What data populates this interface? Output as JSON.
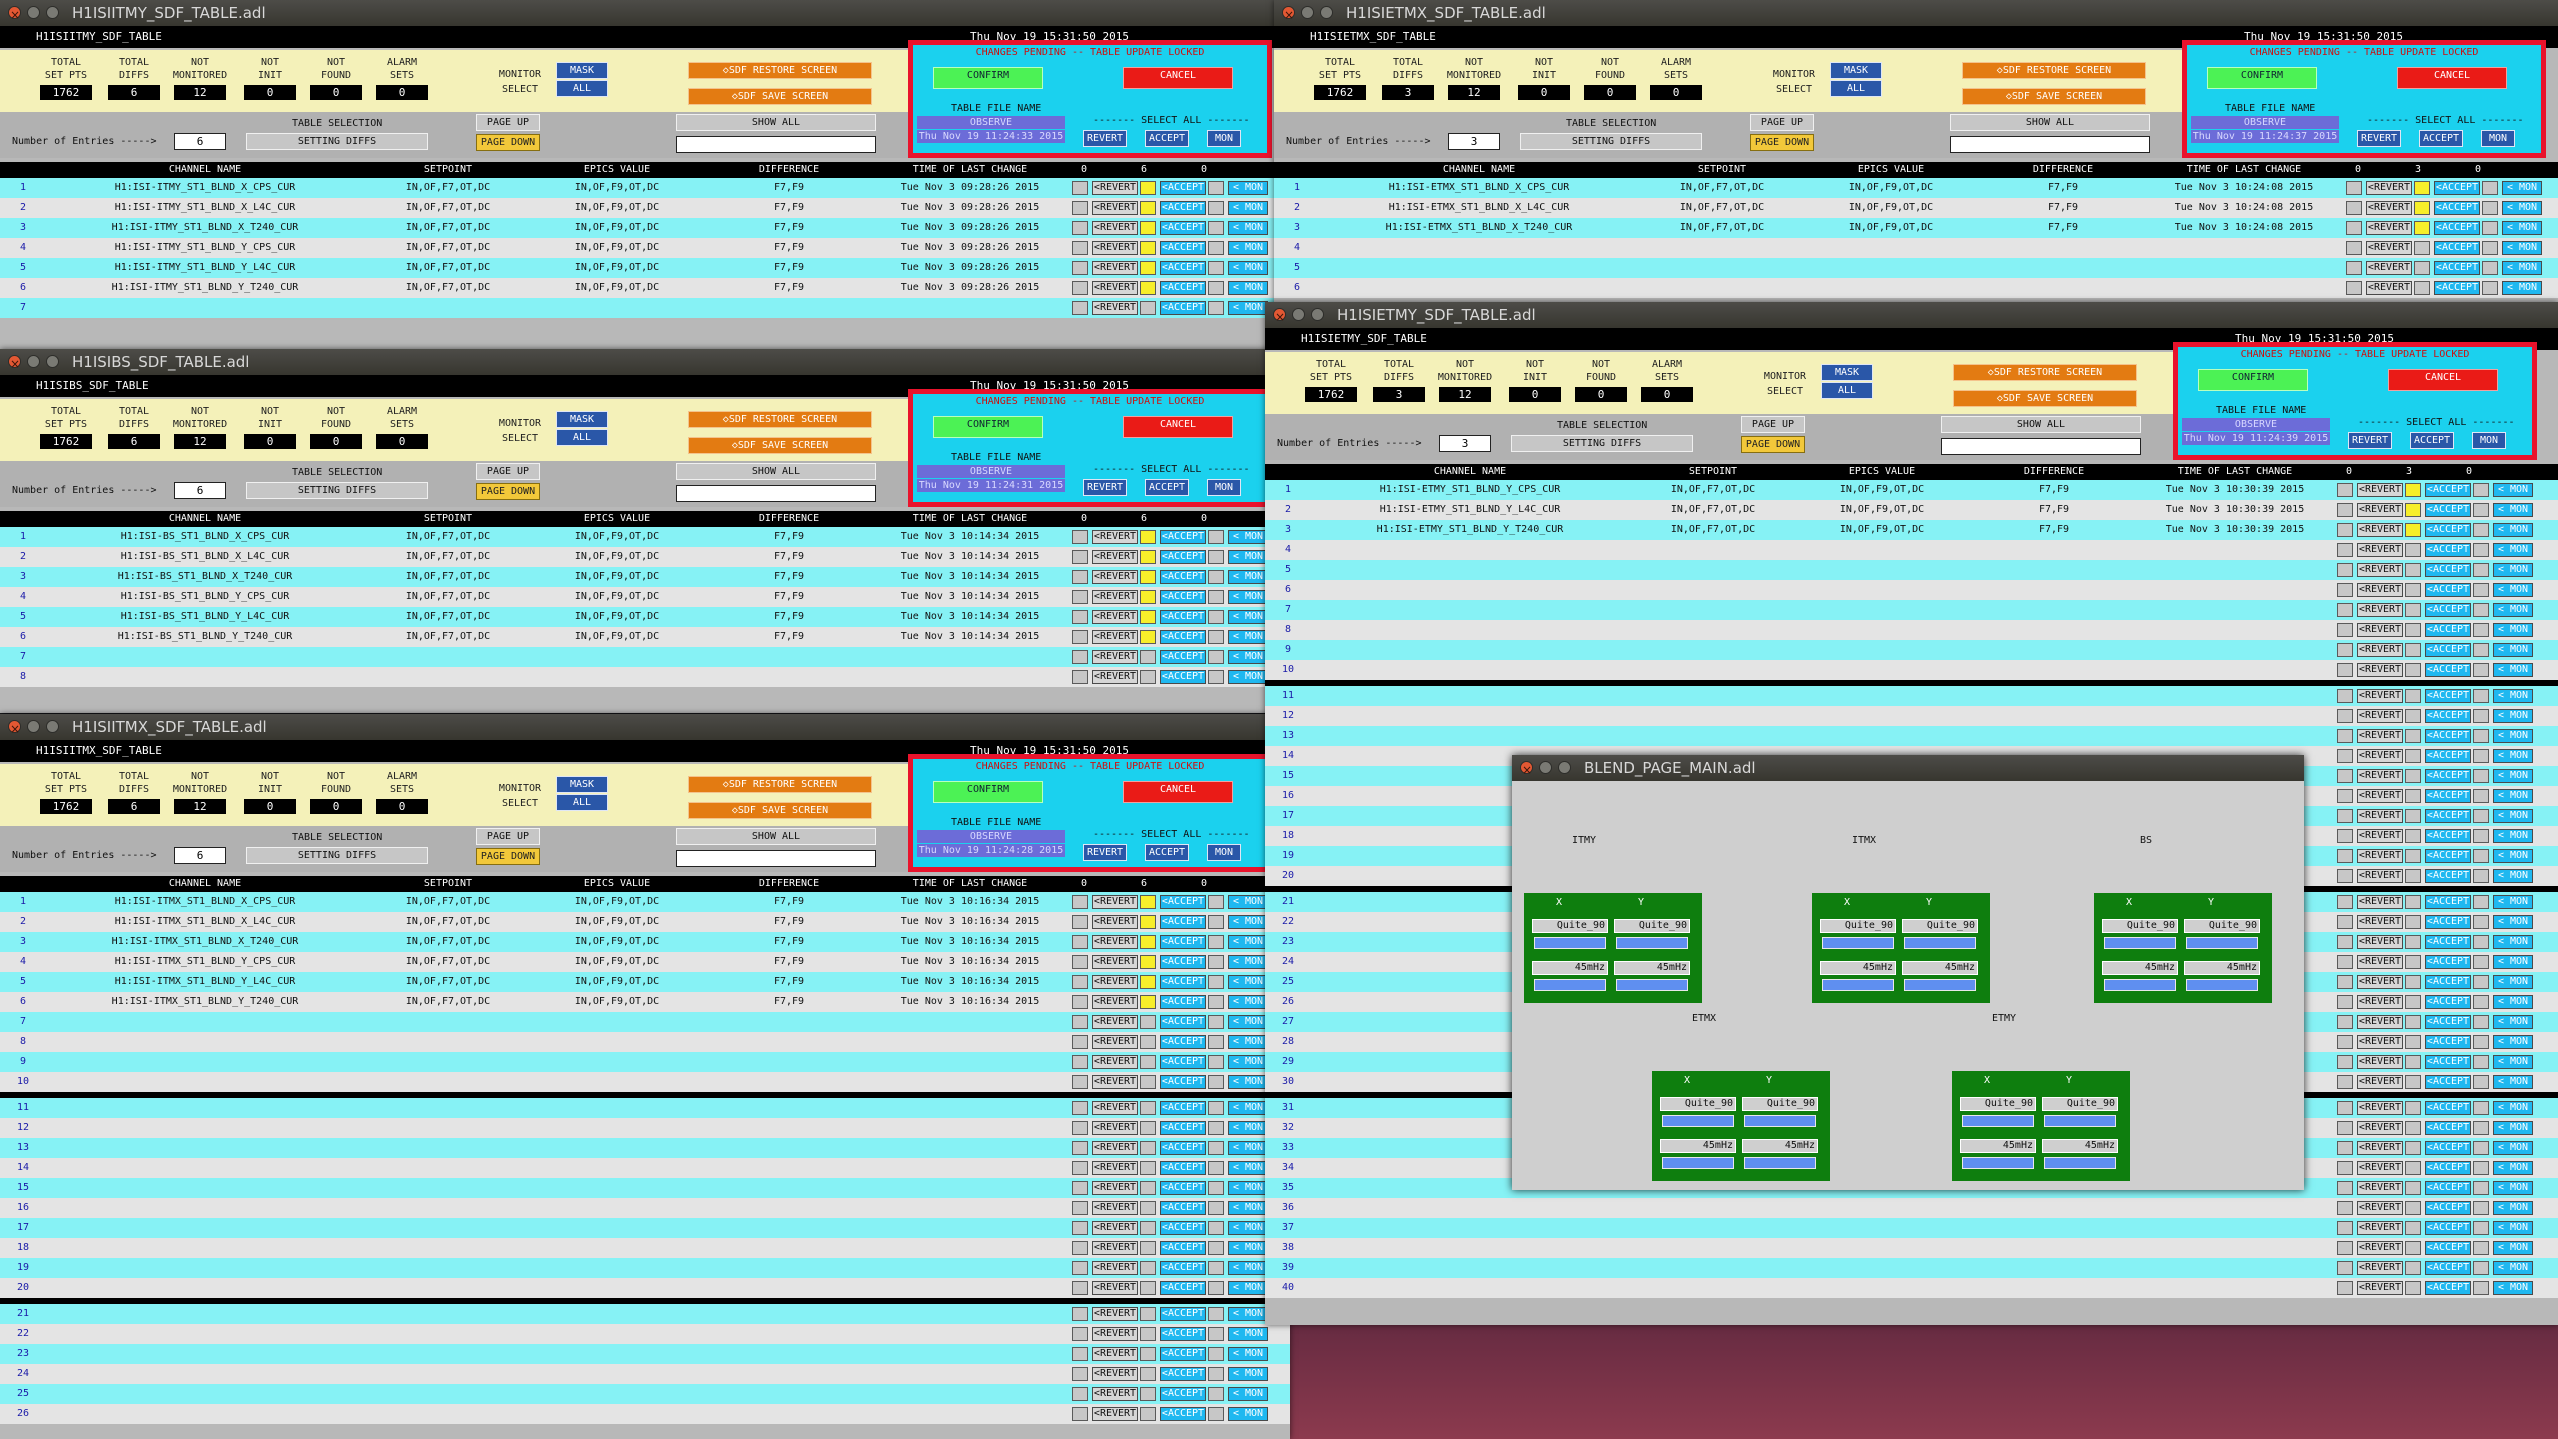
{
  "common": {
    "total_label": "TOTAL",
    "setpts_label": "SET PTS",
    "diffs_label": "DIFFS",
    "not_label": "NOT",
    "monitored_label": "MONITORED",
    "init_label": "INIT",
    "found_label": "FOUND",
    "alarm_label": "ALARM",
    "sets_label": "SETS",
    "monitor_label": "MONITOR",
    "select_label": "SELECT",
    "mask": "MASK",
    "all": "ALL",
    "restore": "SDF RESTORE SCREEN",
    "save": "SDF SAVE SCREEN",
    "changes_pending": "CHANGES PENDING -- TABLE UPDATE LOCKED",
    "confirm": "CONFIRM",
    "cancel": "CANCEL",
    "table_file_name": "TABLE FILE NAME",
    "observe": "OBSERVE",
    "select_all": "------- SELECT ALL -------",
    "revert": "REVERT",
    "accept": "ACCEPT",
    "mon": "MON",
    "table_selection": "TABLE SELECTION",
    "num_entries": "Number of Entries ----->",
    "setting_diffs": "SETTING DIFFS",
    "page_up": "PAGE UP",
    "page_down": "PAGE DOWN",
    "show_all": "SHOW ALL",
    "col_channel": "CHANNEL NAME",
    "col_setpoint": "SETPOINT",
    "col_epics": "EPICS VALUE",
    "col_diff": "DIFFERENCE",
    "col_time": "TIME OF LAST CHANGE",
    "row_revert": "<REVERT",
    "row_accept": "<ACCEPT",
    "row_mon": "< MON"
  },
  "w_itmy": {
    "title": "H1ISIITMY_SDF_TABLE.adl",
    "header": "H1ISIITMY_SDF_TABLE",
    "time": "Thu Nov 19 15:31:50 2015",
    "total": "1762",
    "diffs": "6",
    "notmon": "12",
    "notinit": "0",
    "notfound": "0",
    "alarm": "0",
    "entries": "6",
    "filetime": "Thu Nov 19 11:24:33 2015",
    "c0": "0",
    "c1": "6",
    "c2": "0",
    "rows": [
      {
        "n": "1",
        "ch": "H1:ISI-ITMY_ST1_BLND_X_CPS_CUR",
        "sp": "IN,OF,F7,OT,DC",
        "ev": "IN,OF,F9,OT,DC",
        "df": "F7,F9",
        "tm": "Tue Nov  3 09:28:26 2015"
      },
      {
        "n": "2",
        "ch": "H1:ISI-ITMY_ST1_BLND_X_L4C_CUR",
        "sp": "IN,OF,F7,OT,DC",
        "ev": "IN,OF,F9,OT,DC",
        "df": "F7,F9",
        "tm": "Tue Nov  3 09:28:26 2015"
      },
      {
        "n": "3",
        "ch": "H1:ISI-ITMY_ST1_BLND_X_T240_CUR",
        "sp": "IN,OF,F7,OT,DC",
        "ev": "IN,OF,F9,OT,DC",
        "df": "F7,F9",
        "tm": "Tue Nov  3 09:28:26 2015"
      },
      {
        "n": "4",
        "ch": "H1:ISI-ITMY_ST1_BLND_Y_CPS_CUR",
        "sp": "IN,OF,F7,OT,DC",
        "ev": "IN,OF,F9,OT,DC",
        "df": "F7,F9",
        "tm": "Tue Nov  3 09:28:26 2015"
      },
      {
        "n": "5",
        "ch": "H1:ISI-ITMY_ST1_BLND_Y_L4C_CUR",
        "sp": "IN,OF,F7,OT,DC",
        "ev": "IN,OF,F9,OT,DC",
        "df": "F7,F9",
        "tm": "Tue Nov  3 09:28:26 2015"
      },
      {
        "n": "6",
        "ch": "H1:ISI-ITMY_ST1_BLND_Y_T240_CUR",
        "sp": "IN,OF,F7,OT,DC",
        "ev": "IN,OF,F9,OT,DC",
        "df": "F7,F9",
        "tm": "Tue Nov  3 09:28:26 2015"
      },
      {
        "n": "7",
        "ch": "",
        "sp": "",
        "ev": "",
        "df": "",
        "tm": ""
      }
    ]
  },
  "w_bs": {
    "title": "H1ISIBS_SDF_TABLE.adl",
    "header": "H1ISIBS_SDF_TABLE",
    "time": "Thu Nov 19 15:31:50 2015",
    "total": "1762",
    "diffs": "6",
    "notmon": "12",
    "notinit": "0",
    "notfound": "0",
    "alarm": "0",
    "entries": "6",
    "filetime": "Thu Nov 19 11:24:31 2015",
    "c0": "0",
    "c1": "6",
    "c2": "0",
    "rows": [
      {
        "n": "1",
        "ch": "H1:ISI-BS_ST1_BLND_X_CPS_CUR",
        "sp": "IN,OF,F7,OT,DC",
        "ev": "IN,OF,F9,OT,DC",
        "df": "F7,F9",
        "tm": "Tue Nov  3 10:14:34 2015"
      },
      {
        "n": "2",
        "ch": "H1:ISI-BS_ST1_BLND_X_L4C_CUR",
        "sp": "IN,OF,F7,OT,DC",
        "ev": "IN,OF,F9,OT,DC",
        "df": "F7,F9",
        "tm": "Tue Nov  3 10:14:34 2015"
      },
      {
        "n": "3",
        "ch": "H1:ISI-BS_ST1_BLND_X_T240_CUR",
        "sp": "IN,OF,F7,OT,DC",
        "ev": "IN,OF,F9,OT,DC",
        "df": "F7,F9",
        "tm": "Tue Nov  3 10:14:34 2015"
      },
      {
        "n": "4",
        "ch": "H1:ISI-BS_ST1_BLND_Y_CPS_CUR",
        "sp": "IN,OF,F7,OT,DC",
        "ev": "IN,OF,F9,OT,DC",
        "df": "F7,F9",
        "tm": "Tue Nov  3 10:14:34 2015"
      },
      {
        "n": "5",
        "ch": "H1:ISI-BS_ST1_BLND_Y_L4C_CUR",
        "sp": "IN,OF,F7,OT,DC",
        "ev": "IN,OF,F9,OT,DC",
        "df": "F7,F9",
        "tm": "Tue Nov  3 10:14:34 2015"
      },
      {
        "n": "6",
        "ch": "H1:ISI-BS_ST1_BLND_Y_T240_CUR",
        "sp": "IN,OF,F7,OT,DC",
        "ev": "IN,OF,F9,OT,DC",
        "df": "F7,F9",
        "tm": "Tue Nov  3 10:14:34 2015"
      },
      {
        "n": "7",
        "ch": "",
        "sp": "",
        "ev": "",
        "df": "",
        "tm": ""
      },
      {
        "n": "8",
        "ch": "",
        "sp": "",
        "ev": "",
        "df": "",
        "tm": ""
      }
    ]
  },
  "w_itmx": {
    "title": "H1ISIITMX_SDF_TABLE.adl",
    "header": "H1ISIITMX_SDF_TABLE",
    "time": "Thu Nov 19 15:31:50 2015",
    "total": "1762",
    "diffs": "6",
    "notmon": "12",
    "notinit": "0",
    "notfound": "0",
    "alarm": "0",
    "entries": "6",
    "filetime": "Thu Nov 19 11:24:28 2015",
    "c0": "0",
    "c1": "6",
    "c2": "0",
    "rows": [
      {
        "n": "1",
        "ch": "H1:ISI-ITMX_ST1_BLND_X_CPS_CUR",
        "sp": "IN,OF,F7,OT,DC",
        "ev": "IN,OF,F9,OT,DC",
        "df": "F7,F9",
        "tm": "Tue Nov  3 10:16:34 2015"
      },
      {
        "n": "2",
        "ch": "H1:ISI-ITMX_ST1_BLND_X_L4C_CUR",
        "sp": "IN,OF,F7,OT,DC",
        "ev": "IN,OF,F9,OT,DC",
        "df": "F7,F9",
        "tm": "Tue Nov  3 10:16:34 2015"
      },
      {
        "n": "3",
        "ch": "H1:ISI-ITMX_ST1_BLND_X_T240_CUR",
        "sp": "IN,OF,F7,OT,DC",
        "ev": "IN,OF,F9,OT,DC",
        "df": "F7,F9",
        "tm": "Tue Nov  3 10:16:34 2015"
      },
      {
        "n": "4",
        "ch": "H1:ISI-ITMX_ST1_BLND_Y_CPS_CUR",
        "sp": "IN,OF,F7,OT,DC",
        "ev": "IN,OF,F9,OT,DC",
        "df": "F7,F9",
        "tm": "Tue Nov  3 10:16:34 2015"
      },
      {
        "n": "5",
        "ch": "H1:ISI-ITMX_ST1_BLND_Y_L4C_CUR",
        "sp": "IN,OF,F7,OT,DC",
        "ev": "IN,OF,F9,OT,DC",
        "df": "F7,F9",
        "tm": "Tue Nov  3 10:16:34 2015"
      },
      {
        "n": "6",
        "ch": "H1:ISI-ITMX_ST1_BLND_Y_T240_CUR",
        "sp": "IN,OF,F7,OT,DC",
        "ev": "IN,OF,F9,OT,DC",
        "df": "F7,F9",
        "tm": "Tue Nov  3 10:16:34 2015"
      },
      {
        "n": "7"
      },
      {
        "n": "8"
      },
      {
        "n": "9"
      },
      {
        "n": "10"
      },
      {
        "n": "11"
      },
      {
        "n": "12"
      },
      {
        "n": "13"
      },
      {
        "n": "14"
      },
      {
        "n": "15"
      },
      {
        "n": "16"
      },
      {
        "n": "17"
      },
      {
        "n": "18"
      },
      {
        "n": "19"
      },
      {
        "n": "20"
      },
      {
        "n": "21"
      },
      {
        "n": "22"
      },
      {
        "n": "23"
      },
      {
        "n": "24"
      },
      {
        "n": "25"
      },
      {
        "n": "26"
      }
    ]
  },
  "w_etmx": {
    "title": "H1ISIETMX_SDF_TABLE.adl",
    "header": "H1ISIETMX_SDF_TABLE",
    "time": "Thu Nov 19 15:31:50 2015",
    "total": "1762",
    "diffs": "3",
    "notmon": "12",
    "notinit": "0",
    "notfound": "0",
    "alarm": "0",
    "entries": "3",
    "filetime": "Thu Nov 19 11:24:37 2015",
    "c0": "0",
    "c1": "3",
    "c2": "0",
    "rows": [
      {
        "n": "1",
        "ch": "H1:ISI-ETMX_ST1_BLND_X_CPS_CUR",
        "sp": "IN,OF,F7,OT,DC",
        "ev": "IN,OF,F9,OT,DC",
        "df": "F7,F9",
        "tm": "Tue Nov  3 10:24:08 2015"
      },
      {
        "n": "2",
        "ch": "H1:ISI-ETMX_ST1_BLND_X_L4C_CUR",
        "sp": "IN,OF,F7,OT,DC",
        "ev": "IN,OF,F9,OT,DC",
        "df": "F7,F9",
        "tm": "Tue Nov  3 10:24:08 2015"
      },
      {
        "n": "3",
        "ch": "H1:ISI-ETMX_ST1_BLND_X_T240_CUR",
        "sp": "IN,OF,F7,OT,DC",
        "ev": "IN,OF,F9,OT,DC",
        "df": "F7,F9",
        "tm": "Tue Nov  3 10:24:08 2015"
      },
      {
        "n": "4"
      },
      {
        "n": "5"
      },
      {
        "n": "6"
      }
    ]
  },
  "w_etmy": {
    "title": "H1ISIETMY_SDF_TABLE.adl",
    "header": "H1ISIETMY_SDF_TABLE",
    "time": "Thu Nov 19 15:31:50 2015",
    "total": "1762",
    "diffs": "3",
    "notmon": "12",
    "notinit": "0",
    "notfound": "0",
    "alarm": "0",
    "entries": "3",
    "filetime": "Thu Nov 19 11:24:39 2015",
    "c0": "0",
    "c1": "3",
    "c2": "0",
    "rows": [
      {
        "n": "1",
        "ch": "H1:ISI-ETMY_ST1_BLND_Y_CPS_CUR",
        "sp": "IN,OF,F7,OT,DC",
        "ev": "IN,OF,F9,OT,DC",
        "df": "F7,F9",
        "tm": "Tue Nov  3 10:30:39 2015"
      },
      {
        "n": "2",
        "ch": "H1:ISI-ETMY_ST1_BLND_Y_L4C_CUR",
        "sp": "IN,OF,F7,OT,DC",
        "ev": "IN,OF,F9,OT,DC",
        "df": "F7,F9",
        "tm": "Tue Nov  3 10:30:39 2015"
      },
      {
        "n": "3",
        "ch": "H1:ISI-ETMY_ST1_BLND_Y_T240_CUR",
        "sp": "IN,OF,F7,OT,DC",
        "ev": "IN,OF,F9,OT,DC",
        "df": "F7,F9",
        "tm": "Tue Nov  3 10:30:39 2015"
      },
      {
        "n": "4"
      },
      {
        "n": "5"
      },
      {
        "n": "6"
      },
      {
        "n": "7"
      },
      {
        "n": "8"
      },
      {
        "n": "9"
      },
      {
        "n": "10"
      },
      {
        "n": "11"
      },
      {
        "n": "12"
      },
      {
        "n": "13"
      },
      {
        "n": "14"
      },
      {
        "n": "15"
      },
      {
        "n": "16"
      },
      {
        "n": "17"
      },
      {
        "n": "18"
      },
      {
        "n": "19"
      },
      {
        "n": "20"
      },
      {
        "n": "21"
      },
      {
        "n": "22"
      },
      {
        "n": "23"
      },
      {
        "n": "24"
      },
      {
        "n": "25"
      },
      {
        "n": "26"
      },
      {
        "n": "27"
      },
      {
        "n": "28"
      },
      {
        "n": "29"
      },
      {
        "n": "30"
      },
      {
        "n": "31"
      },
      {
        "n": "32"
      },
      {
        "n": "33"
      },
      {
        "n": "34"
      },
      {
        "n": "35"
      },
      {
        "n": "36"
      },
      {
        "n": "37"
      },
      {
        "n": "38"
      },
      {
        "n": "39"
      },
      {
        "n": "40"
      }
    ]
  },
  "blend": {
    "title": "BLEND_PAGE_MAIN.adl",
    "groups": [
      {
        "name": "ITMY",
        "x": "X",
        "y": "Y",
        "xv": "Quite_90",
        "yv": "Quite_90",
        "xf": "45mHz",
        "yf": "45mHz"
      },
      {
        "name": "ITMX",
        "x": "X",
        "y": "Y",
        "xv": "Quite_90",
        "yv": "Quite_90",
        "xf": "45mHz",
        "yf": "45mHz"
      },
      {
        "name": "BS",
        "x": "X",
        "y": "Y",
        "xv": "Quite_90",
        "yv": "Quite_90",
        "xf": "45mHz",
        "yf": "45mHz"
      },
      {
        "name": "ETMX",
        "x": "X",
        "y": "Y",
        "xv": "Quite_90",
        "yv": "Quite_90",
        "xf": "45mHz",
        "yf": "45mHz"
      },
      {
        "name": "ETMY",
        "x": "X",
        "y": "Y",
        "xv": "Quite_90",
        "yv": "Quite_90",
        "xf": "45mHz",
        "yf": "45mHz"
      }
    ]
  }
}
